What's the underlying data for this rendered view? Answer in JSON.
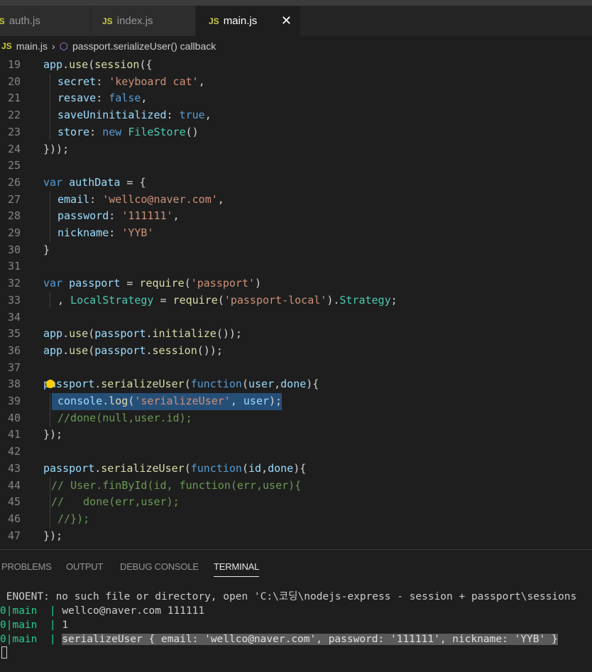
{
  "tabs": [
    {
      "label": "auth.js",
      "icon": "JS",
      "active": false
    },
    {
      "label": "index.js",
      "icon": "JS",
      "active": false
    },
    {
      "label": "main.js",
      "icon": "JS",
      "active": true
    }
  ],
  "tab_close_glyph": "✕",
  "breadcrumb": {
    "file": "main.js",
    "icon": "JS",
    "symbol": "passport.serializeUser() callback"
  },
  "editor": {
    "lines": [
      {
        "n": "19"
      },
      {
        "n": "20"
      },
      {
        "n": "21"
      },
      {
        "n": "22"
      },
      {
        "n": "23"
      },
      {
        "n": "24"
      },
      {
        "n": "25"
      },
      {
        "n": "26"
      },
      {
        "n": "27"
      },
      {
        "n": "28"
      },
      {
        "n": "29"
      },
      {
        "n": "30"
      },
      {
        "n": "31"
      },
      {
        "n": "32"
      },
      {
        "n": "33"
      },
      {
        "n": "34"
      },
      {
        "n": "35"
      },
      {
        "n": "36"
      },
      {
        "n": "37"
      },
      {
        "n": "38"
      },
      {
        "n": "39"
      },
      {
        "n": "40"
      },
      {
        "n": "41"
      },
      {
        "n": "42"
      },
      {
        "n": "43"
      },
      {
        "n": "44"
      },
      {
        "n": "45"
      },
      {
        "n": "46"
      },
      {
        "n": "47"
      }
    ],
    "tokens": {
      "l19": [
        "app",
        ".",
        "use",
        "(",
        "session",
        "({"
      ],
      "l20": [
        "secret",
        ": ",
        "'keyboard cat'",
        ","
      ],
      "l21": [
        "resave",
        ": ",
        "false",
        ","
      ],
      "l22": [
        "saveUninitialized",
        ": ",
        "true",
        ","
      ],
      "l23": [
        "store",
        ": ",
        "new",
        " ",
        "FileStore",
        "()"
      ],
      "l24": [
        "}));"
      ],
      "l26": [
        "var",
        " ",
        "authData",
        " = {"
      ],
      "l27": [
        "email",
        ": ",
        "'wellco@naver.com'",
        ","
      ],
      "l28": [
        "password",
        ": ",
        "'111111'",
        ","
      ],
      "l29": [
        "nickname",
        ": ",
        "'YYB'"
      ],
      "l30": [
        "}"
      ],
      "l32": [
        "var",
        " ",
        "passport",
        " = ",
        "require",
        "(",
        "'passport'",
        ")"
      ],
      "l33": [
        ", ",
        "LocalStrategy",
        " = ",
        "require",
        "(",
        "'passport-local'",
        ").",
        "Strategy",
        ";"
      ],
      "l35": [
        "app",
        ".",
        "use",
        "(",
        "passport",
        ".",
        "initialize",
        "());"
      ],
      "l36": [
        "app",
        ".",
        "use",
        "(",
        "passport",
        ".",
        "session",
        "());"
      ],
      "l38": [
        "passport",
        ".",
        "serializeUser",
        "(",
        "function",
        "(",
        "user",
        ",",
        "done",
        "){"
      ],
      "l39": [
        "console",
        ".",
        "log",
        "(",
        "'serializeUser'",
        ", ",
        "user",
        ");"
      ],
      "l40": [
        "//done(null,user.id);"
      ],
      "l41": [
        "});"
      ],
      "l43": [
        "passport",
        ".",
        "serializeUser",
        "(",
        "function",
        "(",
        "id",
        ",",
        "done",
        "){"
      ],
      "l44": [
        "// User.finById(id, function(err,user){"
      ],
      "l45": [
        "//   done(err,user);"
      ],
      "l46": [
        "//});"
      ],
      "l47": [
        "});"
      ]
    }
  },
  "panel": {
    "tabs": [
      "PROBLEMS",
      "OUTPUT",
      "DEBUG CONSOLE",
      "TERMINAL"
    ],
    "active_tab": "TERMINAL",
    "terminal": {
      "error_line": " ENOENT: no such file or directory, open 'C:\\코딩\\nodejs-express - session + passport\\sessions",
      "rows": [
        {
          "id": "0",
          "name": "main",
          "text": "wellco@naver.com 111111",
          "selected": false
        },
        {
          "id": "0",
          "name": "main",
          "text": "1",
          "selected": false
        },
        {
          "id": "0",
          "name": "main",
          "text": "serializeUser { email: 'wellco@naver.com', password: '111111', nickname: 'YYB' }",
          "selected": true
        }
      ]
    }
  },
  "colors": {
    "keyword": "#569cd6",
    "function": "#dcdcaa",
    "string": "#ce9178",
    "variable": "#9cdcfe",
    "type": "#4ec9b0",
    "comment": "#6a9955",
    "selection": "#264f78"
  }
}
